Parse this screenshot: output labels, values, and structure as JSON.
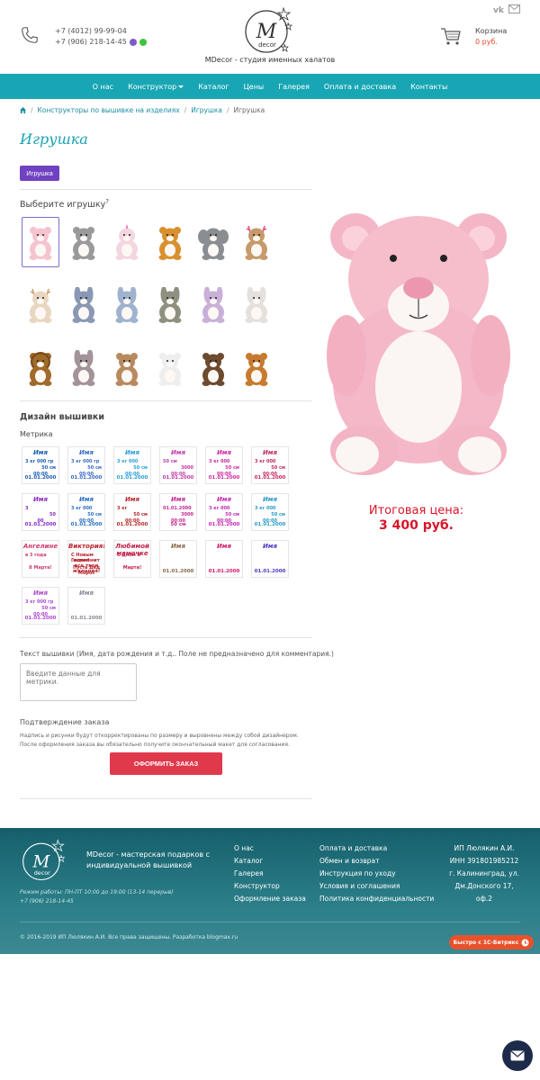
{
  "header": {
    "phone1": "+7 (4012) 99-99-04",
    "phone2": "+7 (906) 218-14-45",
    "tagline": "MDecor - студия именных халатов",
    "logo_text": "decor",
    "cart_label": "Корзина",
    "cart_price": "0 руб."
  },
  "nav": {
    "items": [
      "О нас",
      "Конструктор",
      "Каталог",
      "Цены",
      "Галерея",
      "Оплата и доставка",
      "Контакты"
    ]
  },
  "breadcrumb": {
    "items": [
      "Конструкторы по вышивке на изделиях",
      "Игрушка",
      "Игрушка"
    ]
  },
  "page": {
    "title": "Игрушка",
    "tag_button": "Игрушка",
    "choose_toy": "Выберите игрушку",
    "choose_toy_hint": "?",
    "design_title": "Дизайн вышивки",
    "design_category": "Метрика",
    "price_label": "Итоговая цена:",
    "price_value": "3 400 руб.",
    "text_label": "Текст вышивки (Имя, дата рождения и т.д.. Поле не предназначено для комментария.)",
    "text_placeholder": "Введите данные для метрики.",
    "confirm_label": "Подтверждение заказа",
    "confirm_text": "Надпись и рисунки будут откорректированы по размеру и выровнены между собой дизайнером. После оформления заказа вы обязательно получите окончательный макет для согласования.",
    "order_button": "ОФОРМИТЬ ЗАКАЗ"
  },
  "toys": [
    {
      "color": "#f5c4cf",
      "kind": "bear"
    },
    {
      "color": "#9a9a9a",
      "kind": "cat"
    },
    {
      "color": "#f4d6e0",
      "kind": "unicorn"
    },
    {
      "color": "#d9902f",
      "kind": "giraffe"
    },
    {
      "color": "#8a8d91",
      "kind": "elephant"
    },
    {
      "color": "#c79a6b",
      "kind": "deer"
    },
    {
      "color": "#e8d6c0",
      "kind": "reindeer"
    },
    {
      "color": "#8a98b3",
      "kind": "bunny"
    },
    {
      "color": "#9fb3cf",
      "kind": "bunny"
    },
    {
      "color": "#8f9080",
      "kind": "bunny"
    },
    {
      "color": "#c8b0d8",
      "kind": "bunny"
    },
    {
      "color": "#e5e0dc",
      "kind": "bunny"
    },
    {
      "color": "#a06a2a",
      "kind": "lion"
    },
    {
      "color": "#a3939a",
      "kind": "bunny"
    },
    {
      "color": "#b88a5f",
      "kind": "bear"
    },
    {
      "color": "#eeeeee",
      "kind": "bear"
    },
    {
      "color": "#6e4a2e",
      "kind": "bear"
    },
    {
      "color": "#c87a2e",
      "kind": "tiger"
    }
  ],
  "designs": [
    {
      "name": "Имя",
      "w": "3 кг 000 гр",
      "h": "50 см",
      "time": "00:00",
      "date": "01.01.2000",
      "c": "#1c5fb8"
    },
    {
      "name": "Имя",
      "w": "3 кг 000 гр",
      "h": "50 см",
      "time": "00:00",
      "date": "01.01.2000",
      "c": "#3a6cc7"
    },
    {
      "name": "Имя",
      "w": "3 кг 000",
      "h": "50 см",
      "time": "00:00",
      "date": "01.01.2000",
      "c": "#2aa0d8"
    },
    {
      "name": "Имя",
      "w": "50 см",
      "h": "3000",
      "time": "00:00",
      "date": "01.01.2000",
      "c": "#c23aa8"
    },
    {
      "name": "Имя",
      "w": "3 кг 000",
      "h": "50 см",
      "time": "00:00",
      "date": "01.01.2000",
      "c": "#d02aa0"
    },
    {
      "name": "Имя",
      "w": "3 кг 000",
      "h": "50 см",
      "time": "00:00",
      "date": "01.01.2000",
      "c": "#c42a60"
    },
    {
      "name": "Имя",
      "w": "3",
      "h": "50",
      "time": "00",
      "date": "01.01.2000",
      "c": "#8a2ac4"
    },
    {
      "name": "Имя",
      "w": "3 кг 000",
      "h": "50 см",
      "time": "00:00",
      "date": "01.01.2000",
      "c": "#2a70c4"
    },
    {
      "name": "Имя",
      "w": "3 кг",
      "h": "50 см",
      "time": "00:00",
      "date": "01.01.2000",
      "c": "#b82a2a"
    },
    {
      "name": "Имя",
      "w": "01.01.2000",
      "h": "3000",
      "time": "00:00",
      "date": "50 см",
      "c": "#c42a90"
    },
    {
      "name": "Имя",
      "w": "3 кг 000",
      "h": "50 см",
      "time": "00:00",
      "date": "01.01.2000",
      "c": "#c42ab0"
    },
    {
      "name": "Имя",
      "w": "3 кг 000",
      "h": "50 см",
      "time": "00:00",
      "date": "01.01.2000",
      "c": "#2a9ac4"
    },
    {
      "name": "Ангелине",
      "w": "в 3 года",
      "h": "",
      "time": "8 Марта!",
      "date": "",
      "c": "#d03a6a"
    },
    {
      "name": "Виктория!",
      "w": "С Новым Годом!",
      "h": "",
      "time": "Пусть Дед Мороз",
      "date": "исполнит все твои желания!",
      "c": "#b8222a"
    },
    {
      "name": "Любимой мамочке",
      "w": "С Днём 8",
      "h": "",
      "time": "Марта!",
      "date": "",
      "c": "#c4224a"
    },
    {
      "name": "Имя",
      "w": "",
      "h": "",
      "time": "",
      "date": "01.01.2000",
      "c": "#8a6a4a"
    },
    {
      "name": "Имя",
      "w": "",
      "h": "",
      "time": "",
      "date": "01.01.2000",
      "c": "#d01a6a"
    },
    {
      "name": "Имя",
      "w": "",
      "h": "",
      "time": "",
      "date": "01.01.2000",
      "c": "#4a3ac4"
    },
    {
      "name": "Имя",
      "w": "3 кг 000 гр",
      "h": "50 см",
      "time": "00:00",
      "date": "01.01.2000",
      "c": "#b04ad0"
    },
    {
      "name": "Имя",
      "w": "",
      "h": "",
      "time": "",
      "date": "01.01.2000",
      "c": "#8a8a9a"
    }
  ],
  "footer": {
    "about": "MDecor - мастерская подарков с индивидуальной вышивкой",
    "hours": "Режим работы: ПН-ПТ 10:00 до 19:00 (13-14 перерыв)",
    "phone": "+7 (906) 218-14-45",
    "col1": [
      "О нас",
      "Каталог",
      "Галерея",
      "Конструктор",
      "Оформление заказа"
    ],
    "col2": [
      "Оплата и доставка",
      "Обмен и возврат",
      "Инструкция по уходу",
      "Условия и соглашения",
      "Политика конфиденциальности"
    ],
    "req": [
      "ИП Люлякин А.И.",
      "ИНН 391801985212",
      "г. Калининград, ул. Дм.Донского 17, оф.2"
    ],
    "copyright": "© 2016-2019 ИП Люлякин А.И. Все права защищены. Разработка blogmax.ru",
    "bitrix": "Быстро с 1С-Битрикс"
  },
  "colors": {
    "accent": "#18a6b4",
    "price": "#d9162a",
    "tag": "#6f42c1",
    "order": "#e0394c"
  }
}
